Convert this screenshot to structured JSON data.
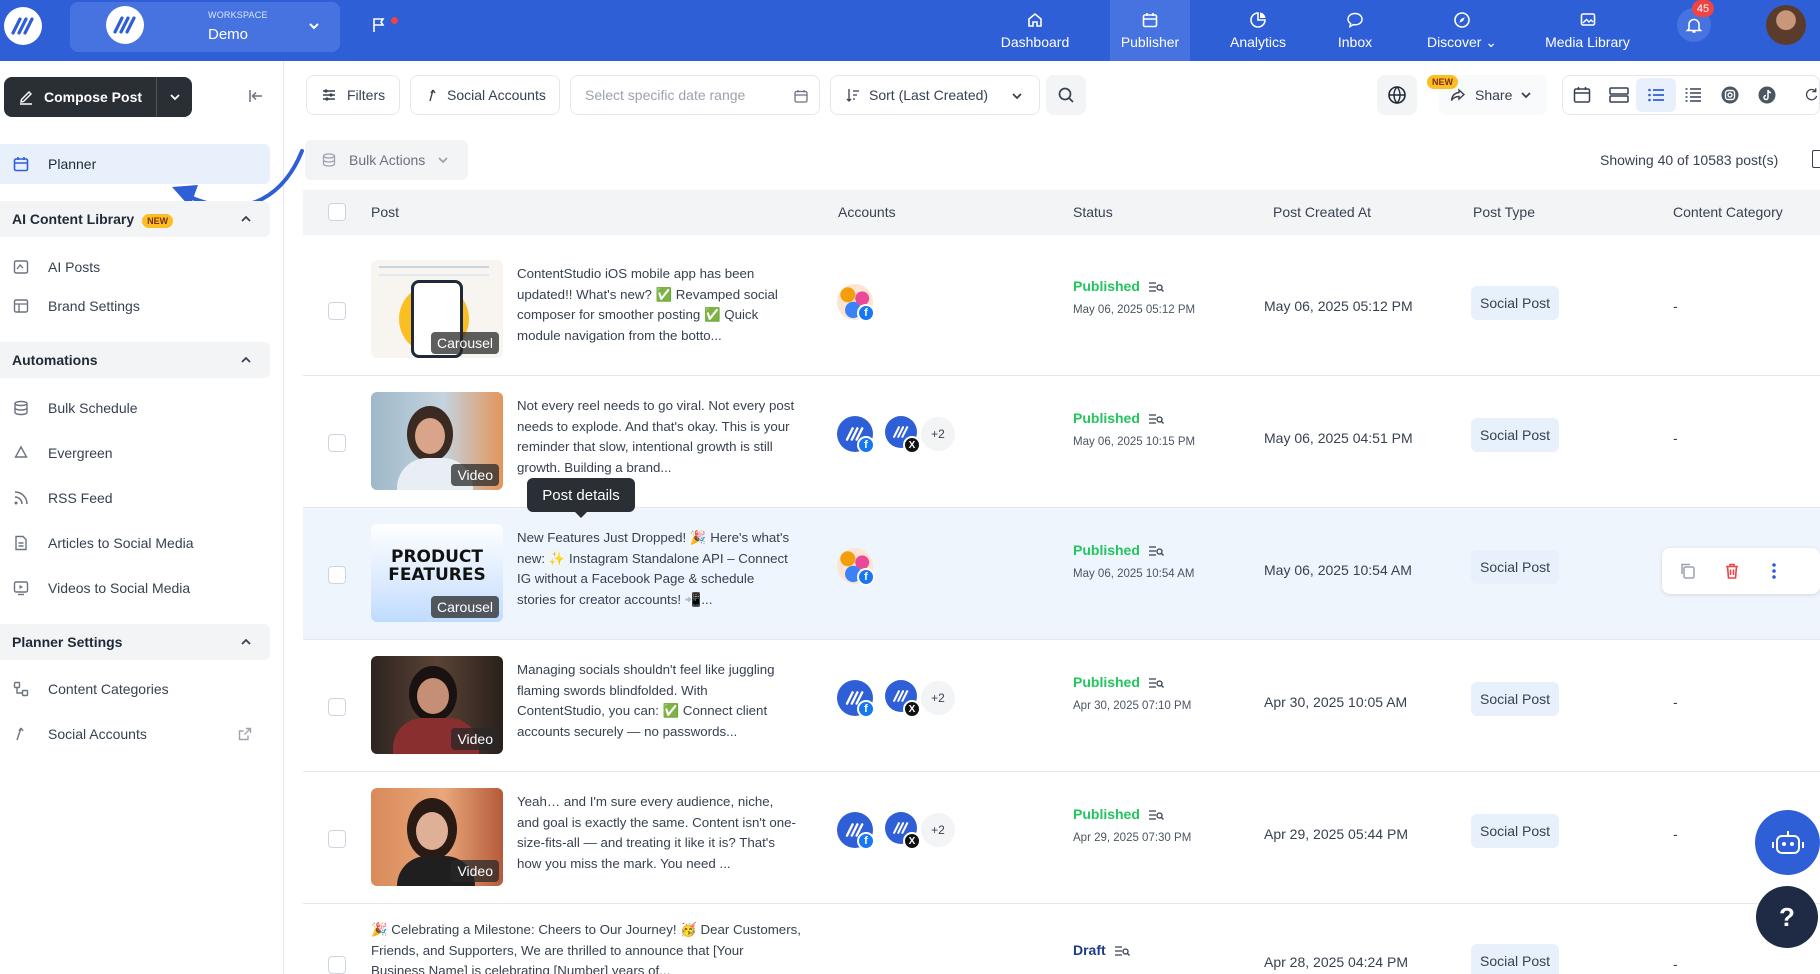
{
  "header": {
    "workspace_label": "WORKSPACE",
    "workspace_name": "Demo",
    "nav": [
      {
        "label": "Dashboard",
        "icon": "home-icon"
      },
      {
        "label": "Publisher",
        "icon": "calendar-icon",
        "active": true
      },
      {
        "label": "Analytics",
        "icon": "chart-pie-icon"
      },
      {
        "label": "Inbox",
        "icon": "chat-icon"
      },
      {
        "label": "Discover",
        "icon": "compass-icon"
      },
      {
        "label": "Media Library",
        "icon": "image-icon"
      }
    ],
    "notification_count": "45"
  },
  "sidebar": {
    "compose_label": "Compose Post",
    "planner_label": "Planner",
    "ai_section": {
      "title": "AI Content Library",
      "badge": "NEW",
      "items": [
        "AI Posts",
        "Brand Settings"
      ]
    },
    "automations": {
      "title": "Automations",
      "items": [
        "Bulk Schedule",
        "Evergreen",
        "RSS Feed",
        "Articles to Social Media",
        "Videos to Social Media"
      ]
    },
    "planner_settings": {
      "title": "Planner Settings",
      "items": [
        "Content Categories",
        "Social Accounts"
      ]
    }
  },
  "toolbar": {
    "filters": "Filters",
    "social_accounts": "Social Accounts",
    "date_placeholder": "Select specific date range",
    "sort": "Sort (Last Created)",
    "share": "Share",
    "new_badge": "NEW",
    "bulk_actions": "Bulk Actions",
    "showing": "Showing 40 of 10583 post(s)"
  },
  "table": {
    "columns": [
      "Post",
      "Accounts",
      "Status",
      "Post Created At",
      "Post Type",
      "Content Category"
    ],
    "rows": [
      {
        "thumb_tag": "Carousel",
        "text": "ContentStudio iOS mobile app has been updated!! What's new? ✅ Revamped social composer for smoother posting ✅ Quick module navigation from the botto...",
        "status": "Published",
        "status_date": "May 06, 2025 05:12 PM",
        "created": "May 06, 2025 05:12 PM",
        "type": "Social Post",
        "category": "-"
      },
      {
        "thumb_tag": "Video",
        "text": "Not every reel needs to go viral. Not every post needs to explode. And that's okay. This is your reminder that slow, intentional growth is still growth. Building a brand...",
        "status": "Published",
        "status_date": "May 06, 2025 10:15 PM",
        "created": "May 06, 2025 04:51 PM",
        "type": "Social Post",
        "category": "-",
        "extra": "+2"
      },
      {
        "thumb_tag": "Carousel",
        "thumb_title": "PRODUCT FEATURES",
        "text": "New Features Just Dropped! 🎉 Here's what's new: ✨ Instagram Standalone API – Connect IG without a Facebook Page & schedule stories for creator accounts! 📲...",
        "status": "Published",
        "status_date": "May 06, 2025 10:54 AM",
        "created": "May 06, 2025 10:54 AM",
        "type": "Social Post",
        "category": ""
      },
      {
        "thumb_tag": "Video",
        "text": "Managing socials shouldn't feel like juggling flaming swords blindfolded. With ContentStudio, you can: ✅ Connect client accounts securely — no passwords...",
        "status": "Published",
        "status_date": "Apr 30, 2025 07:10 PM",
        "created": "Apr 30, 2025 10:05 AM",
        "type": "Social Post",
        "category": "-",
        "extra": "+2"
      },
      {
        "thumb_tag": "Video",
        "text": "Yeah… and I'm sure every audience, niche, and goal is exactly the same. Content isn't one-size-fits-all — and treating it like it is? That's how you miss the mark. You need ...",
        "status": "Published",
        "status_date": "Apr 29, 2025 07:30 PM",
        "created": "Apr 29, 2025 05:44 PM",
        "type": "Social Post",
        "category": "-",
        "extra": "+2"
      },
      {
        "thumb_tag": "",
        "text": "🎉 Celebrating a Milestone: Cheers to Our Journey! 🥳 Dear Customers, Friends, and Supporters, We are thrilled to announce that [Your Business Name] is celebrating [Number] years of...",
        "status": "Draft",
        "status_date": "",
        "created": "Apr 28, 2025 04:24 PM",
        "type": "Social Post",
        "category": "-"
      }
    ]
  },
  "tooltip": "Post details",
  "help_label": "?"
}
